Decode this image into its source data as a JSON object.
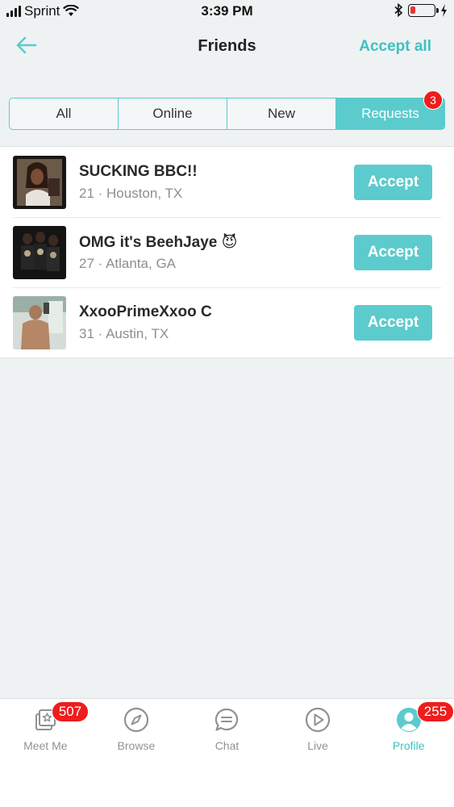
{
  "status_bar": {
    "carrier": "Sprint",
    "time": "3:39 PM",
    "battery_level": 0.2,
    "icons": [
      "signal-icon",
      "wifi-icon",
      "bluetooth-icon",
      "battery-icon",
      "charging-icon"
    ]
  },
  "header": {
    "back_icon": "arrow-left-icon",
    "title": "Friends",
    "accept_all_label": "Accept all"
  },
  "segments": {
    "items": [
      {
        "label": "All"
      },
      {
        "label": "Online"
      },
      {
        "label": "New"
      },
      {
        "label": "Requests",
        "badge": "3"
      }
    ],
    "active": "Requests"
  },
  "requests": [
    {
      "name": "SUCKING BBC!!",
      "meta": "21 · Houston, TX",
      "accept_label": "Accept"
    },
    {
      "name": "OMG it's BeehJaye 😈",
      "meta": "27 · Atlanta, GA",
      "accept_label": "Accept"
    },
    {
      "name": "XxooPrimeXxoo C",
      "meta": "31 · Austin, TX",
      "accept_label": "Accept"
    }
  ],
  "tab_bar": {
    "tabs": [
      {
        "label": "Meet Me",
        "icon": "meet-me-icon",
        "badge": "507"
      },
      {
        "label": "Browse",
        "icon": "compass-icon"
      },
      {
        "label": "Chat",
        "icon": "chat-icon"
      },
      {
        "label": "Live",
        "icon": "play-icon"
      },
      {
        "label": "Profile",
        "icon": "profile-icon",
        "badge": "255"
      }
    ],
    "active": "Profile"
  },
  "colors": {
    "accent": "#5ccbcd",
    "accent_text": "#3fc1c3",
    "badge": "#ef1d1d",
    "background": "#eff2f3"
  }
}
